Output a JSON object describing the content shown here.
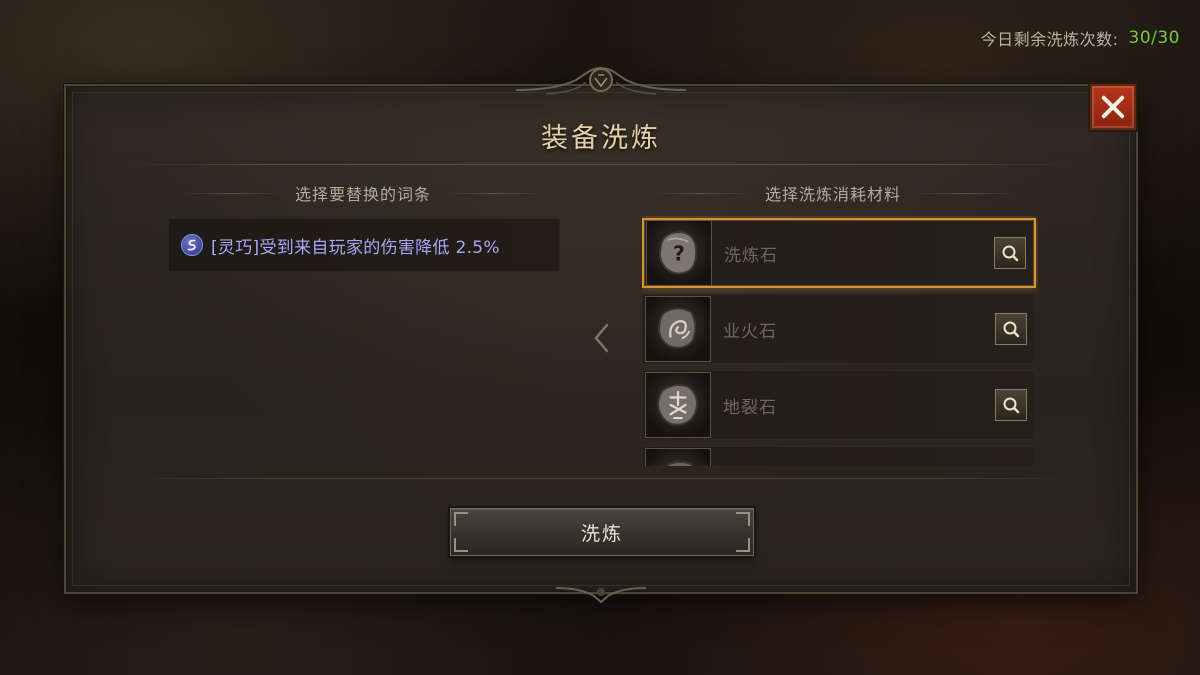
{
  "hud": {
    "remaining_label": "今日剩余洗炼次数:",
    "remaining_count": "30/30",
    "remaining_color": "#6fcf3b"
  },
  "dialog": {
    "title": "装备洗炼",
    "close_icon": "close-icon",
    "left_section_title": "选择要替换的词条",
    "right_section_title": "选择洗炼消耗材料",
    "affix": {
      "icon": "agility-swirl-icon",
      "text": "[灵巧]受到来自玩家的伤害降低 2.5%",
      "color": "#a9a5f4"
    },
    "materials": [
      {
        "name": "洗炼石",
        "icon": "unknown-rune-stone-icon",
        "selected": true
      },
      {
        "name": "业火石",
        "icon": "dragon-rune-stone-icon",
        "selected": false
      },
      {
        "name": "地裂石",
        "icon": "glyph-rune-stone-icon",
        "selected": false
      },
      {
        "name": "",
        "icon": "rune-stone-icon",
        "selected": false
      }
    ],
    "selected_border_color": "#d7932f",
    "refine_button_label": "洗炼"
  }
}
